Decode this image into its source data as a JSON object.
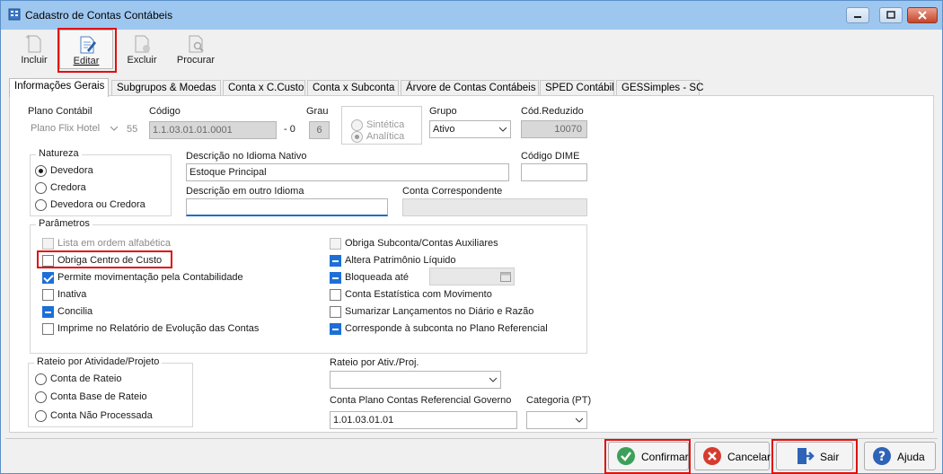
{
  "window": {
    "title": "Cadastro de Contas Contábeis"
  },
  "toolbar": {
    "incluir": "Incluir",
    "editar": "Editar",
    "excluir": "Excluir",
    "procurar": "Procurar"
  },
  "tabs": [
    "Informações Gerais",
    "Subgrupos & Moedas",
    "Conta x C.Custo",
    "Conta x Subconta",
    "Árvore de Contas Contábeis",
    "SPED Contábil",
    "GESSimples - SC"
  ],
  "form": {
    "plano_label": "Plano Contábil",
    "plano_value": "Plano Flix Hotel",
    "plano_num": "55",
    "codigo_label": "Código",
    "codigo_value": "1.1.03.01.01.0001",
    "codigo_suffix": "- 0",
    "grau_label": "Grau",
    "grau_value": "6",
    "sintetica": "Sintética",
    "analitica": "Analítica",
    "grupo_label": "Grupo",
    "grupo_value": "Ativo",
    "codreduzido_label": "Cód.Reduzido",
    "codreduzido_value": "10070",
    "natureza_title": "Natureza",
    "devedora": "Devedora",
    "credora": "Credora",
    "devedora_credora": "Devedora ou Credora",
    "desc_nativo_label": "Descrição no Idioma Nativo",
    "desc_nativo_value": "Estoque Principal",
    "codigo_dime_label": "Código DIME",
    "desc_outro_label": "Descrição em outro Idioma",
    "conta_corr_label": "Conta Correspondente",
    "parametros_title": "Parâmetros",
    "p_lista": "Lista em ordem alfabética",
    "p_obriga_cc": "Obriga Centro de Custo",
    "p_permite": "Permite movimentação pela Contabilidade",
    "p_inativa": "Inativa",
    "p_concilia": "Concilia",
    "p_imprime": "Imprime no Relatório de Evolução das Contas",
    "p_obriga_sub": "Obriga Subconta/Contas Auxiliares",
    "p_altera": "Altera Patrimônio Líquido",
    "p_bloqueada": "Bloqueada até",
    "p_estatistica": "Conta Estatística com Movimento",
    "p_sumarizar": "Sumarizar Lançamentos no Diário e Razão",
    "p_corresponde": "Corresponde à subconta no Plano Referencial",
    "rateio_title": "Rateio por Atividade/Projeto",
    "r_rateio": "Conta de Rateio",
    "r_base": "Conta Base de Rateio",
    "r_nao": "Conta Não Processada",
    "rateio_ativ_label": "Rateio por Ativ./Proj.",
    "conta_ref_label": "Conta Plano Contas Referencial Governo",
    "conta_ref_value": "1.01.03.01.01",
    "categoria_label": "Categoria (PT)"
  },
  "buttons": {
    "confirmar": "Confirmar",
    "cancelar": "Cancelar",
    "sair": "Sair",
    "ajuda": "Ajuda"
  },
  "colors": {
    "accent": "#1d6fd6",
    "highlight": "#e01010",
    "titlebar": "#9ec7f0"
  }
}
